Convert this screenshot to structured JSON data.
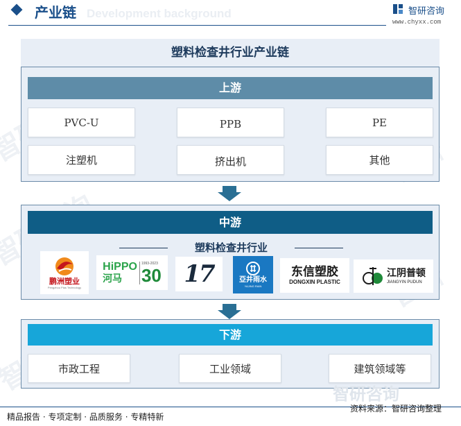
{
  "header": {
    "title": "产业链",
    "background_text": "Development background",
    "brand_name": "智研咨询",
    "brand_url": "www.chyxx.com"
  },
  "diagram": {
    "title": "塑料检查井行业产业链",
    "upstream": {
      "label": "上游",
      "items": [
        "PVC-U",
        "PPB",
        "PE",
        "注塑机",
        "挤出机",
        "其他"
      ]
    },
    "midstream": {
      "label": "中游",
      "subtitle": "塑料检查井行业",
      "companies": [
        {
          "name": "鹏洲塑业",
          "sub": "Pengzhou Plas Technology"
        },
        {
          "name": "河马",
          "brand": "HiPPO",
          "years": "1993-2023",
          "mark": "30"
        },
        {
          "name": "17"
        },
        {
          "name": "亞井雨水",
          "sub": "YAJING RAIN"
        },
        {
          "name": "东信塑胶",
          "sub": "DONGXIN PLASTIC"
        },
        {
          "name": "江阴普顿",
          "sub": "JIANGYIN PUDUN"
        }
      ]
    },
    "downstream": {
      "label": "下游",
      "items": [
        "市政工程",
        "工业领域",
        "建筑领域等"
      ]
    }
  },
  "footer": {
    "left": "精品报告 · 专项定制 · 品质服务 · 专精特新",
    "source": "资料来源：智研咨询整理"
  },
  "colors": {
    "upstream_bar": "#5e8ca8",
    "midstream_bar": "#0f5d86",
    "downstream_bar": "#17a6d9",
    "arrow": "#2a6f94",
    "panel_bg": "#e8eef6"
  }
}
